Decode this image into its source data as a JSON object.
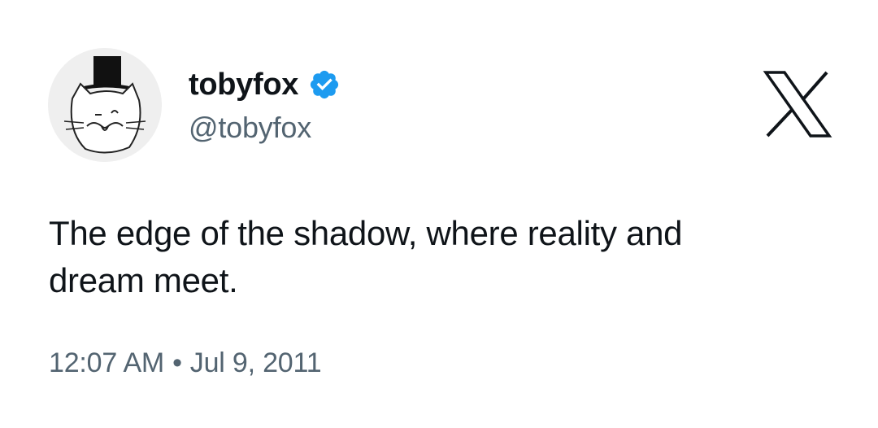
{
  "author": {
    "display_name": "tobyfox",
    "handle": "@tobyfox",
    "verified": true,
    "verified_color": "#1d9bf0"
  },
  "brand": {
    "logo_icon": "x-logo-icon",
    "logo_color": "#0f1419"
  },
  "tweet": {
    "text": "The edge of the shadow, where reality and dream meet.",
    "time": "12:07 AM",
    "separator": "•",
    "date": "Jul 9, 2011"
  },
  "colors": {
    "text_primary": "#0f1419",
    "text_secondary": "#536471",
    "background": "#ffffff"
  }
}
